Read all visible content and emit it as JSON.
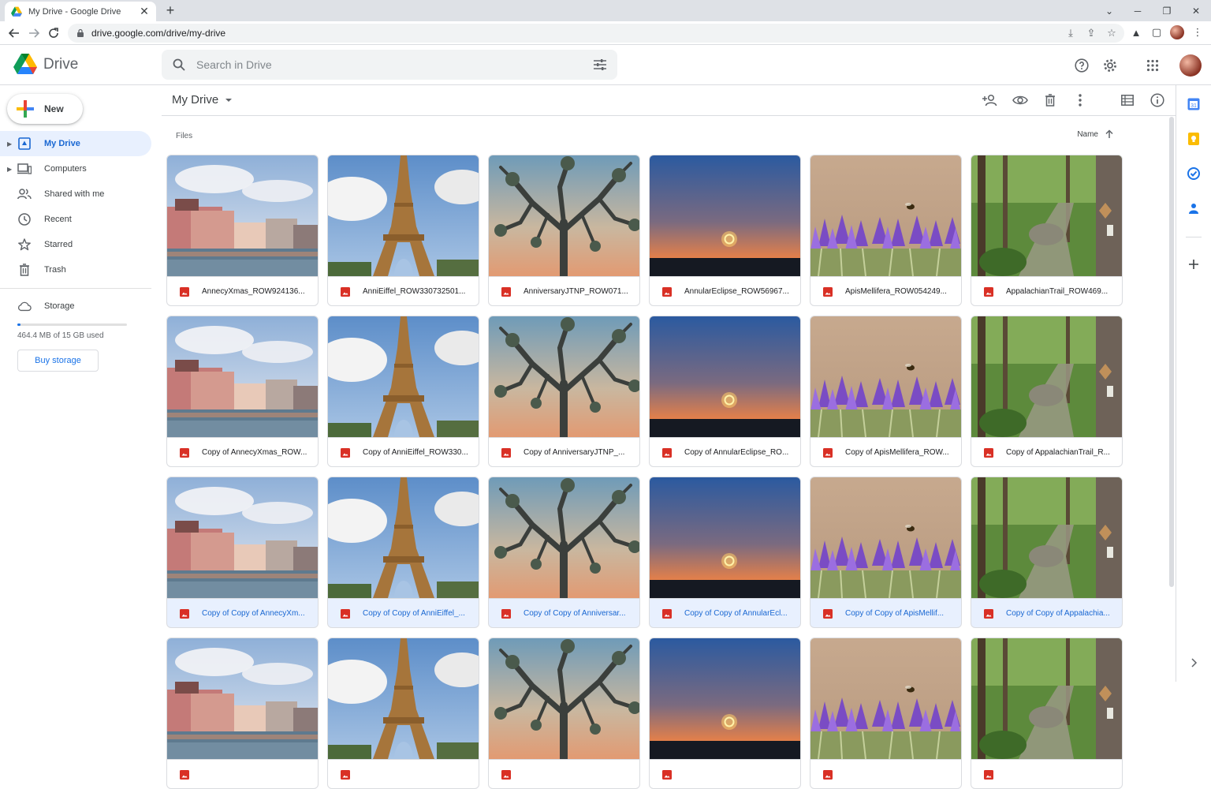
{
  "browser": {
    "tab_title": "My Drive - Google Drive",
    "url": "drive.google.com/drive/my-drive"
  },
  "header": {
    "logo_text": "Drive",
    "search_placeholder": "Search in Drive"
  },
  "sidebar": {
    "new_label": "New",
    "items": [
      {
        "label": "My Drive",
        "icon": "my-drive-icon"
      },
      {
        "label": "Computers",
        "icon": "computers-icon"
      },
      {
        "label": "Shared with me",
        "icon": "shared-icon"
      },
      {
        "label": "Recent",
        "icon": "clock-icon"
      },
      {
        "label": "Starred",
        "icon": "star-icon"
      },
      {
        "label": "Trash",
        "icon": "trash-icon"
      }
    ],
    "storage_label": "Storage",
    "storage_text": "464.4 MB of 15 GB used",
    "storage_fraction": 0.03,
    "buy_storage_label": "Buy storage"
  },
  "main": {
    "location": "My Drive",
    "files_label": "Files",
    "sort_label": "Name"
  },
  "files": [
    {
      "name": "AnnecyXmas_ROW924136...",
      "thumb": "annecy"
    },
    {
      "name": "AnniEiffel_ROW330732501...",
      "thumb": "eiffel"
    },
    {
      "name": "AnniversaryJTNP_ROW071...",
      "thumb": "joshua"
    },
    {
      "name": "AnnularEclipse_ROW56967...",
      "thumb": "eclipse"
    },
    {
      "name": "ApisMellifera_ROW054249...",
      "thumb": "bee"
    },
    {
      "name": "AppalachianTrail_ROW469...",
      "thumb": "trail"
    },
    {
      "name": "Copy of AnnecyXmas_ROW...",
      "thumb": "annecy"
    },
    {
      "name": "Copy of AnniEiffel_ROW330...",
      "thumb": "eiffel"
    },
    {
      "name": "Copy of AnniversaryJTNP_...",
      "thumb": "joshua"
    },
    {
      "name": "Copy of AnnularEclipse_RO...",
      "thumb": "eclipse"
    },
    {
      "name": "Copy of ApisMellifera_ROW...",
      "thumb": "bee"
    },
    {
      "name": "Copy of AppalachianTrail_R...",
      "thumb": "trail"
    },
    {
      "name": "Copy of Copy of AnnecyXm...",
      "thumb": "annecy",
      "selected": true
    },
    {
      "name": "Copy of Copy of AnniEiffel_...",
      "thumb": "eiffel",
      "selected": true
    },
    {
      "name": "Copy of Copy of Anniversar...",
      "thumb": "joshua",
      "selected": true
    },
    {
      "name": "Copy of Copy of AnnularEcl...",
      "thumb": "eclipse",
      "selected": true
    },
    {
      "name": "Copy of Copy of ApisMellif...",
      "thumb": "bee",
      "selected": true
    },
    {
      "name": "Copy of Copy of Appalachia...",
      "thumb": "trail",
      "selected": true
    },
    {
      "name": "",
      "thumb": "annecy"
    },
    {
      "name": "",
      "thumb": "eiffel"
    },
    {
      "name": "",
      "thumb": "joshua"
    },
    {
      "name": "",
      "thumb": "eclipse"
    },
    {
      "name": "",
      "thumb": "bee"
    },
    {
      "name": "",
      "thumb": "trail"
    }
  ],
  "colors": {
    "accent": "#1a73e8",
    "selected_bg": "#e8f0fe",
    "image_icon": "#d93025"
  }
}
